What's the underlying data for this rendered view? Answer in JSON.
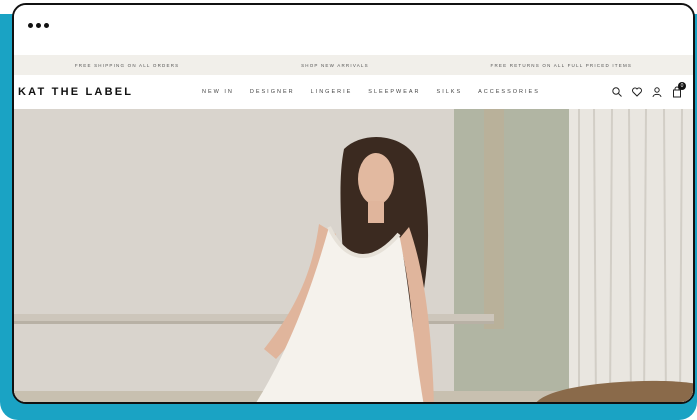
{
  "window": {
    "menu_icon": "ellipsis-icon"
  },
  "announcement": {
    "items": [
      "FREE SHIPPING ON ALL ORDERS",
      "SHOP NEW ARRIVALS",
      "FREE RETURNS ON ALL FULL PRICED ITEMS"
    ]
  },
  "header": {
    "brand": "KAT THE LABEL",
    "menu": [
      "NEW IN",
      "DESIGNER",
      "LINGERIE",
      "SLEEPWEAR",
      "SILKS",
      "ACCESSORIES"
    ],
    "icons": [
      "search-icon",
      "heart-icon",
      "account-icon",
      "cart-icon"
    ],
    "cart_count": "0"
  },
  "hero": {
    "image": "hero-model-photo"
  },
  "colors": {
    "frame": "#1aa3c4",
    "announcement_bg": "#f1efea",
    "text": "#111111"
  }
}
